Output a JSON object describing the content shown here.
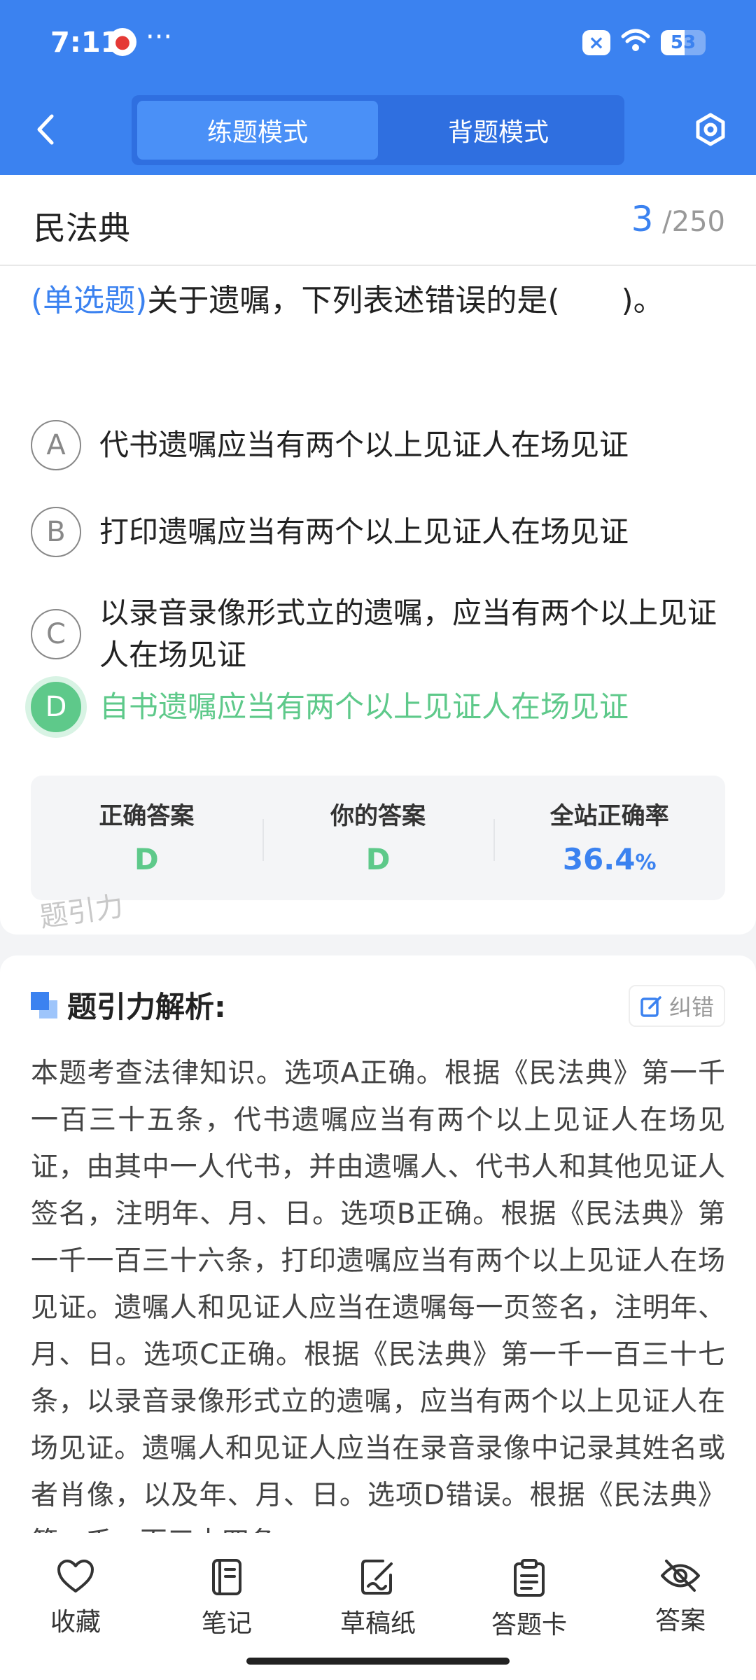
{
  "status_bar": {
    "time": "7:11",
    "dots": "···",
    "battery": "53",
    "battery_level": 0.53
  },
  "header": {
    "mode_tabs": [
      {
        "label": "练题模式",
        "active": true
      },
      {
        "label": "背题模式",
        "active": false
      }
    ]
  },
  "subject": {
    "name": "民法典",
    "current": "3",
    "total": "250",
    "separator": "/"
  },
  "question": {
    "type": "(单选题)",
    "text": "关于遗嘱，下列表述错误的是(　　)。",
    "options": [
      {
        "letter": "A",
        "text": "代书遗嘱应当有两个以上见证人在场见证"
      },
      {
        "letter": "B",
        "text": "打印遗嘱应当有两个以上见证人在场见证"
      },
      {
        "letter": "C",
        "text": "以录音录像形式立的遗嘱，应当有两个以上见证人在场见证"
      },
      {
        "letter": "D",
        "text": "自书遗嘱应当有两个以上见证人在场见证"
      }
    ]
  },
  "answers": {
    "correct_label": "正确答案",
    "correct_value": "D",
    "yours_label": "你的答案",
    "yours_value": "D",
    "rate_label": "全站正确率",
    "rate_value": "36.4",
    "rate_unit": "%"
  },
  "watermark": "题引力",
  "analysis": {
    "title": "题引力解析:",
    "report_label": "纠错",
    "body": "本题考查法律知识。选项A正确。根据《民法典》第一千一百三十五条，代书遗嘱应当有两个以上见证人在场见证，由其中一人代书，并由遗嘱人、代书人和其他见证人签名，注明年、月、日。选项B正确。根据《民法典》第一千一百三十六条，打印遗嘱应当有两个以上见证人在场见证。遗嘱人和见证人应当在遗嘱每一页签名，注明年、月、日。选项C正确。根据《民法典》第一千一百三十七条，以录音录像形式立的遗嘱，应当有两个以上见证人在场见证。遗嘱人和见证人应当在录音录像中记录其姓名或者肖像，以及年、月、日。选项D错误。根据《民法典》第一千一百三十四条"
  },
  "tabbar": [
    {
      "label": "收藏",
      "icon": "heart-icon"
    },
    {
      "label": "笔记",
      "icon": "notebook-icon"
    },
    {
      "label": "草稿纸",
      "icon": "draft-icon"
    },
    {
      "label": "答题卡",
      "icon": "clipboard-icon"
    },
    {
      "label": "答案",
      "icon": "eye-off-icon"
    }
  ],
  "colors": {
    "primary": "#3b82f0",
    "correct": "#5ec98a"
  }
}
